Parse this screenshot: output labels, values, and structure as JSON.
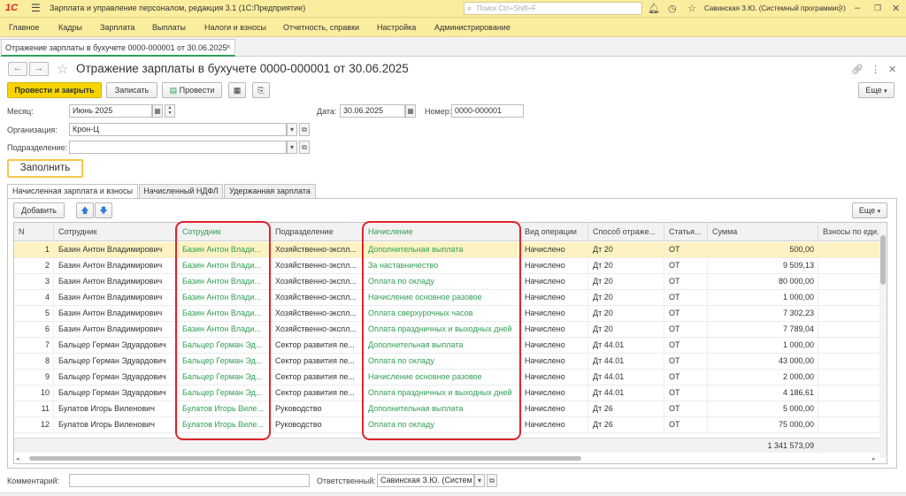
{
  "app": {
    "logo": "1С",
    "title": "Зарплата и управление персоналом, редакция 3.1  (1С:Предприятие)",
    "search_placeholder": "Поиск Ctrl+Shift+F",
    "user": "Савинская З.Ю. (Системный программист)"
  },
  "menu": [
    "Главное",
    "Кадры",
    "Зарплата",
    "Выплаты",
    "Налоги и взносы",
    "Отчетность, справки",
    "Настройка",
    "Администрирование"
  ],
  "doc_tab": {
    "label": "Отражение зарплаты в бухучете 0000-000001 от 30.06.2025",
    "close": "×"
  },
  "form": {
    "title": "Отражение зарплаты в бухучете 0000-000001 от 30.06.2025",
    "more": "Еще"
  },
  "toolbar": {
    "post_close": "Провести и закрыть",
    "save": "Записать",
    "post": "Провести"
  },
  "fields": {
    "month_label": "Месяц:",
    "month_value": "Июнь 2025",
    "date_label": "Дата:",
    "date_value": "30.06.2025",
    "number_label": "Номер:",
    "number_value": "0000-000001",
    "org_label": "Организация:",
    "org_value": "Крон-Ц",
    "dept_label": "Подразделение:",
    "dept_value": ""
  },
  "fill_button": "Заполнить",
  "tabs": [
    "Начисленная зарплата и взносы",
    "Начисленный НДФЛ",
    "Удержанная зарплата"
  ],
  "table_toolbar": {
    "add": "Добавить",
    "more": "Еще"
  },
  "table": {
    "columns": [
      "N",
      "Сотрудник",
      "Сотрудник",
      "Подразделение",
      "Начисление",
      "Вид операции",
      "Способ отраже...",
      "Статья...",
      "Сумма",
      "Взносы по еди..."
    ],
    "rows": [
      [
        "1",
        "Базин Антон Владимирович",
        "Базин Антон Влади...",
        "Хозяйственно-экспл...",
        "Дополнительная выплата",
        "Начислено",
        "Дт 20",
        "ОТ",
        "500,00"
      ],
      [
        "2",
        "Базин Антон Владимирович",
        "Базин Антон Влади...",
        "Хозяйственно-экспл...",
        "За наставничество",
        "Начислено",
        "Дт 20",
        "ОТ",
        "9 509,13"
      ],
      [
        "3",
        "Базин Антон Владимирович",
        "Базин Антон Влади...",
        "Хозяйственно-экспл...",
        "Оплата по окладу",
        "Начислено",
        "Дт 20",
        "ОТ",
        "80 000,00"
      ],
      [
        "4",
        "Базин Антон Владимирович",
        "Базин Антон Влади...",
        "Хозяйственно-экспл...",
        "Начисление основное разовое",
        "Начислено",
        "Дт 20",
        "ОТ",
        "1 000,00"
      ],
      [
        "5",
        "Базин Антон Владимирович",
        "Базин Антон Влади...",
        "Хозяйственно-экспл...",
        "Оплата сверхурочных часов",
        "Начислено",
        "Дт 20",
        "ОТ",
        "7 302,23"
      ],
      [
        "6",
        "Базин Антон Владимирович",
        "Базин Антон Влади...",
        "Хозяйственно-экспл...",
        "Оплата праздничных и выходных дней",
        "Начислено",
        "Дт 20",
        "ОТ",
        "7 789,04"
      ],
      [
        "7",
        "Бальцер Герман Эдуардович",
        "Бальцер Герман Эд...",
        "Сектор развития пе...",
        "Дополнительная выплата",
        "Начислено",
        "Дт 44.01",
        "ОТ",
        "1 000,00"
      ],
      [
        "8",
        "Бальцер Герман Эдуардович",
        "Бальцер Герман Эд...",
        "Сектор развития пе...",
        "Оплата по окладу",
        "Начислено",
        "Дт 44.01",
        "ОТ",
        "43 000,00"
      ],
      [
        "9",
        "Бальцер Герман Эдуардович",
        "Бальцер Герман Эд...",
        "Сектор развития пе...",
        "Начисление основное разовое",
        "Начислено",
        "Дт 44.01",
        "ОТ",
        "2 000,00"
      ],
      [
        "10",
        "Бальцер Герман Эдуардович",
        "Бальцер Герман Эд...",
        "Сектор развития пе...",
        "Оплата праздничных и выходных дней",
        "Начислено",
        "Дт 44.01",
        "ОТ",
        "4 186,61"
      ],
      [
        "11",
        "Булатов Игорь Виленович",
        "Булатов Игорь Виле...",
        "Руководство",
        "Дополнительная выплата",
        "Начислено",
        "Дт 26",
        "ОТ",
        "5 000,00"
      ],
      [
        "12",
        "Булатов Игорь Виленович",
        "Булатов Игорь Виле...",
        "Руководство",
        "Оплата по окладу",
        "Начислено",
        "Дт 26",
        "ОТ",
        "75 000,00"
      ]
    ],
    "total": "1 341 573,09"
  },
  "bottom": {
    "comment_label": "Комментарий:",
    "comment_value": "",
    "responsible_label": "Ответственный:",
    "responsible_value": "Савинская З.Ю. (Систем"
  },
  "colors": {
    "accent_yellow": "#f6d400",
    "header_yellow": "#fbed9e",
    "green_text": "#2f9e52",
    "highlight_red": "#e0242a"
  }
}
